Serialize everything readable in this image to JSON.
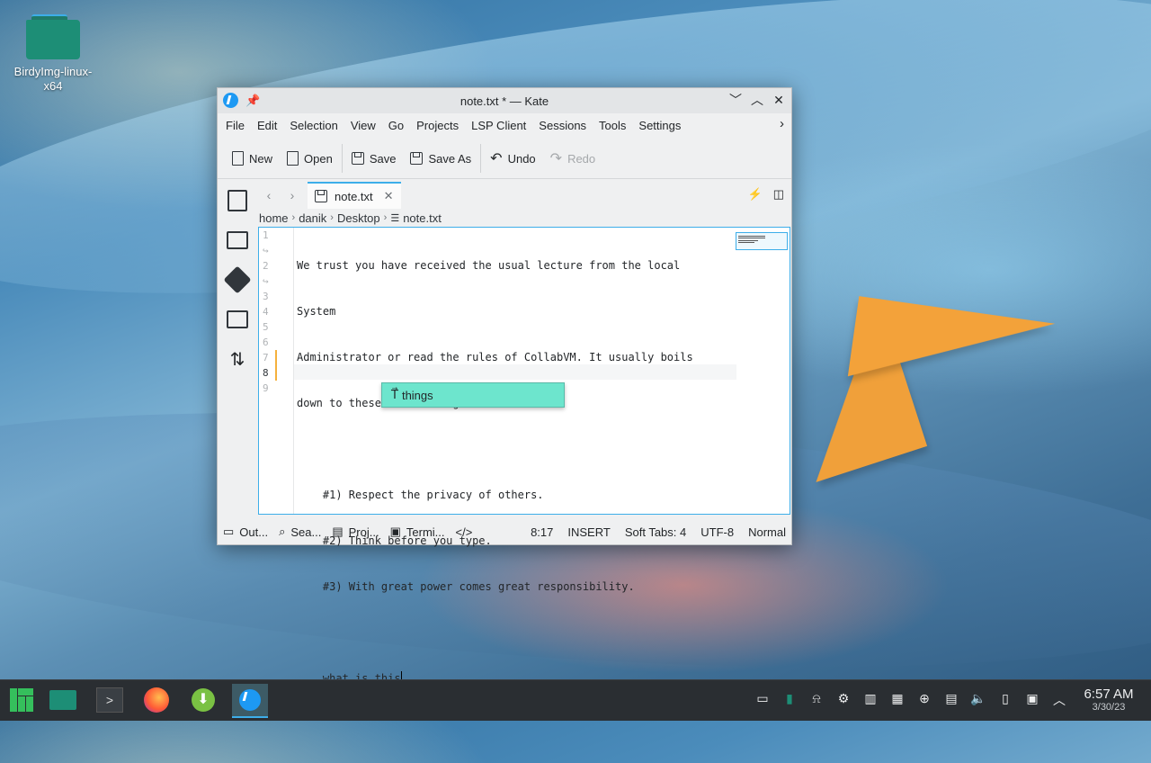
{
  "desktop": {
    "icon_label": "BirdyImg-linux-x64"
  },
  "window": {
    "title": "note.txt * — Kate",
    "menu": [
      "File",
      "Edit",
      "Selection",
      "View",
      "Go",
      "Projects",
      "LSP Client",
      "Sessions",
      "Tools",
      "Settings"
    ],
    "toolbar": {
      "new": "New",
      "open": "Open",
      "save": "Save",
      "save_as": "Save As",
      "undo": "Undo",
      "redo": "Redo"
    },
    "tab": {
      "label": "note.txt"
    },
    "breadcrumb": [
      "home",
      "danik",
      "Desktop",
      "note.txt"
    ],
    "editor": {
      "lines": [
        {
          "num": "1",
          "text": "We trust you have received the usual lecture from the local"
        },
        {
          "num": "↪",
          "text": "System"
        },
        {
          "num": "2",
          "text": "Administrator or read the rules of CollabVM. It usually boils"
        },
        {
          "num": "↪",
          "text": "down to these three things:"
        },
        {
          "num": "3",
          "text": ""
        },
        {
          "num": "4",
          "text": "    #1) Respect the privacy of others."
        },
        {
          "num": "5",
          "text": "    #2) Think before you type."
        },
        {
          "num": "6",
          "text": "    #3) With great power comes great responsibility."
        },
        {
          "num": "7",
          "text": ""
        },
        {
          "num": "8",
          "text": "    what is this"
        },
        {
          "num": "9",
          "text": ""
        }
      ],
      "completion": "things"
    },
    "statusbar": {
      "output": "Out...",
      "search": "Sea...",
      "projects": "Proj...",
      "terminal": "Termi...",
      "position": "8:17",
      "mode": "INSERT",
      "indent": "Soft Tabs: 4",
      "encoding": "UTF-8",
      "syntax": "Normal"
    }
  },
  "taskbar": {
    "time": "6:57 AM",
    "date": "3/30/23"
  },
  "colors": {
    "accent": "#3daee9",
    "completion_bg": "#6de5cd",
    "modified_marker": "#f5b13d",
    "taskbar_bg": "#2a2e32"
  }
}
